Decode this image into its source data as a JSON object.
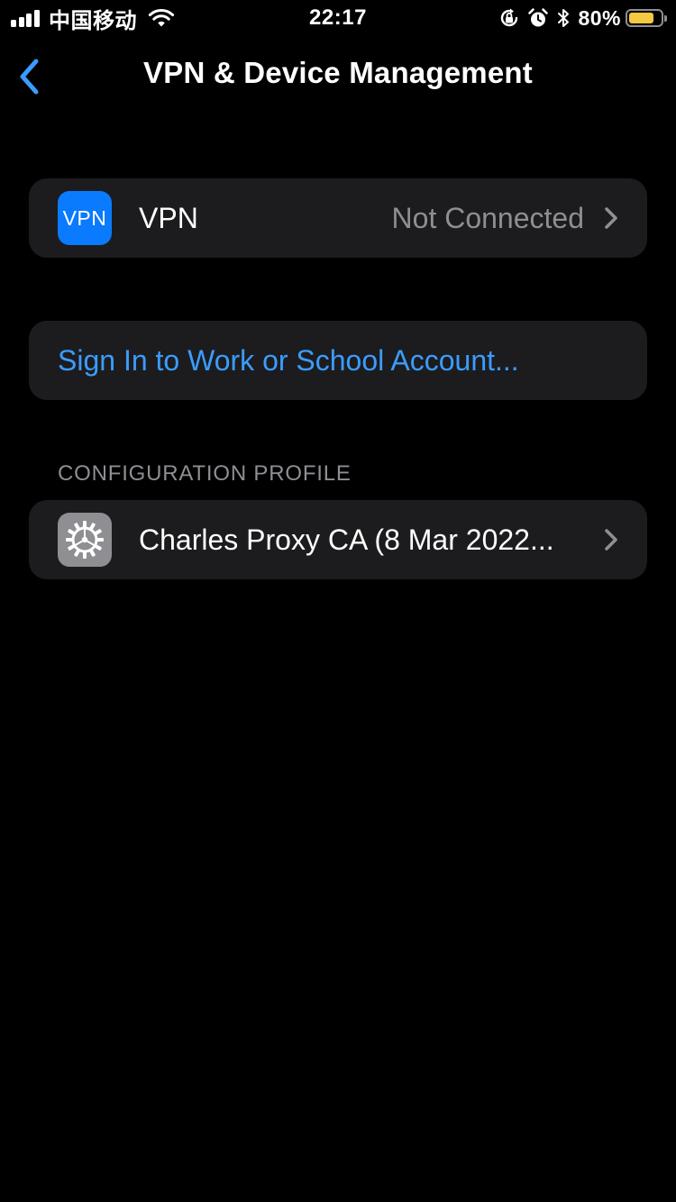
{
  "status_bar": {
    "carrier": "中国移动",
    "time": "22:17",
    "battery_percent": "80%",
    "battery_level": 0.8,
    "battery_color": "#f5c842",
    "icons": [
      "signal-icon",
      "wifi-icon",
      "orientation-lock-icon",
      "alarm-icon",
      "bluetooth-icon",
      "battery-icon"
    ]
  },
  "nav": {
    "back_icon": "chevron-left-icon",
    "title": "VPN & Device Management"
  },
  "vpn_group": {
    "icon_text": "VPN",
    "label": "VPN",
    "status": "Not Connected"
  },
  "account_group": {
    "link_label": "Sign In to Work or School Account..."
  },
  "profiles": {
    "section_header": "CONFIGURATION PROFILE",
    "items": [
      {
        "label": "Charles Proxy CA (8 Mar 2022...",
        "icon": "settings-gear-icon"
      }
    ]
  },
  "colors": {
    "background": "#000000",
    "cell_background": "#1c1c1e",
    "accent": "#3b9cff",
    "vpn_icon_bg": "#0a7aff",
    "secondary_text": "#8e8e93"
  }
}
